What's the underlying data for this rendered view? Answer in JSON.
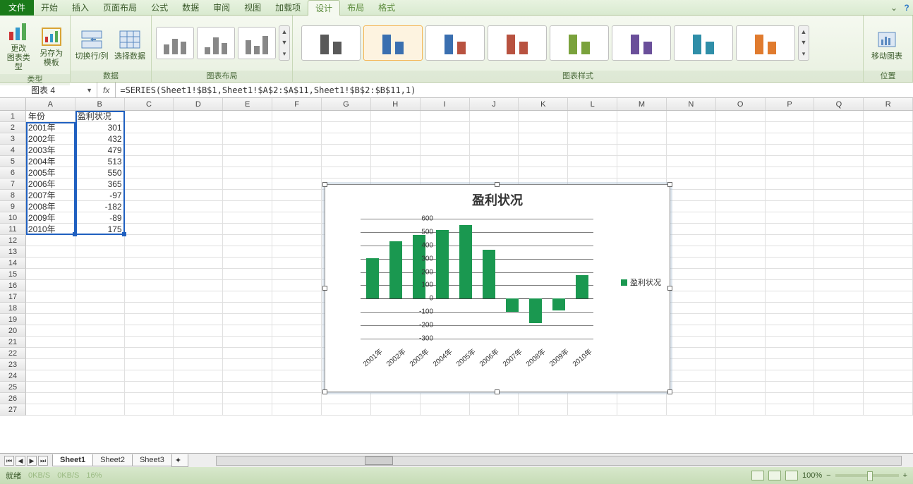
{
  "tabs": {
    "file": "文件",
    "home": "开始",
    "insert": "插入",
    "pagelayout": "页面布局",
    "formulas": "公式",
    "data": "数据",
    "review": "审阅",
    "view": "视图",
    "addins": "加载项",
    "design": "设计",
    "layout": "布局",
    "format": "格式"
  },
  "ribbon": {
    "change_type": "更改\n图表类型",
    "save_tpl": "另存为\n模板",
    "switch_rc": "切换行/列",
    "select_data": "选择数据",
    "move_chart": "移动图表",
    "grp_type": "类型",
    "grp_data": "数据",
    "grp_layout": "图表布局",
    "grp_style": "图表样式",
    "grp_loc": "位置"
  },
  "namebox": "图表 4",
  "formula": "=SERIES(Sheet1!$B$1,Sheet1!$A$2:$A$11,Sheet1!$B$2:$B$11,1)",
  "columns": [
    "A",
    "B",
    "C",
    "D",
    "E",
    "F",
    "G",
    "H",
    "I",
    "J",
    "K",
    "L",
    "M",
    "N",
    "O",
    "P",
    "Q",
    "R"
  ],
  "table": {
    "header": [
      "年份",
      "盈利状况"
    ],
    "rows": [
      [
        "2001年",
        301
      ],
      [
        "2002年",
        432
      ],
      [
        "2003年",
        479
      ],
      [
        "2004年",
        513
      ],
      [
        "2005年",
        550
      ],
      [
        "2006年",
        365
      ],
      [
        "2007年",
        -97
      ],
      [
        "2008年",
        -182
      ],
      [
        "2009年",
        -89
      ],
      [
        "2010年",
        175
      ]
    ]
  },
  "chart_data": {
    "type": "bar",
    "title": "盈利状况",
    "legend": "盈利状况",
    "categories": [
      "2001年",
      "2002年",
      "2003年",
      "2004年",
      "2005年",
      "2006年",
      "2007年",
      "2008年",
      "2009年",
      "2010年"
    ],
    "values": [
      301,
      432,
      479,
      513,
      550,
      365,
      -97,
      -182,
      -89,
      175
    ],
    "ylim": [
      -300,
      600
    ],
    "yticks": [
      -300,
      -200,
      -100,
      0,
      100,
      200,
      300,
      400,
      500,
      600
    ],
    "xlabel": "",
    "ylabel": ""
  },
  "style_colors": [
    [
      "#595959",
      "#595959"
    ],
    [
      "#3a6fb0",
      "#3a6fb0"
    ],
    [
      "#3a6fb0",
      "#b85240"
    ],
    [
      "#b85240",
      "#b85240"
    ],
    [
      "#7aa23c",
      "#7aa23c"
    ],
    [
      "#6a4f9a",
      "#6a4f9a"
    ],
    [
      "#2f8ea8",
      "#2f8ea8"
    ],
    [
      "#e07b2e",
      "#e07b2e"
    ]
  ],
  "sheets": [
    "Sheet1",
    "Sheet2",
    "Sheet3"
  ],
  "status": {
    "ready": "就绪",
    "kb1": "0KB/S",
    "kb2": "0KB/S",
    "pct": "16%",
    "zoom": "100%"
  }
}
